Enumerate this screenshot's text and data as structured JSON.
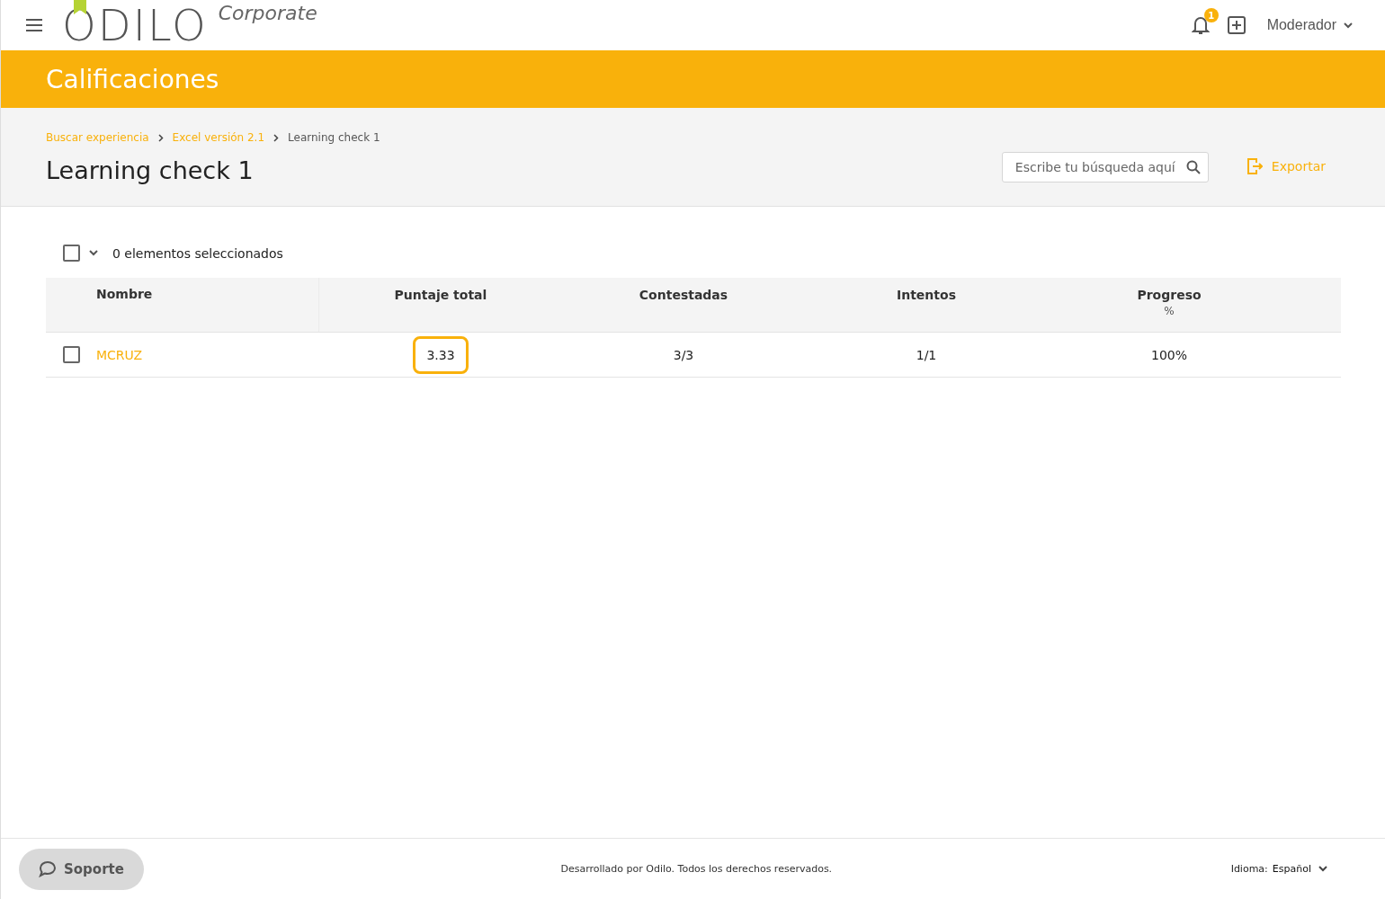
{
  "header": {
    "logo": "ODILO",
    "logo_suffix": "Corporate",
    "notification_count": "1",
    "user_menu": "Moderador"
  },
  "banner": {
    "title": "Calificaciones"
  },
  "breadcrumbs": [
    {
      "label": "Buscar experiencia",
      "kind": "link"
    },
    {
      "label": "Excel versión 2.1",
      "kind": "link"
    },
    {
      "label": "Learning check 1",
      "kind": "current"
    }
  ],
  "page_title": "Learning check 1",
  "search": {
    "placeholder": "Escribe tu búsqueda aquí"
  },
  "export_button": "Exportar",
  "selection": {
    "checked": false,
    "label": "0 elementos seleccionados"
  },
  "table": {
    "columns": [
      {
        "label": "Nombre"
      },
      {
        "label": "Puntaje total"
      },
      {
        "label": "Contestadas"
      },
      {
        "label": "Intentos"
      },
      {
        "label": "Progreso",
        "sublabel": "%"
      }
    ],
    "rows": [
      {
        "checked": false,
        "cells": [
          {
            "text": "MCRUZ",
            "kind": "link",
            "highlighted": false
          },
          {
            "text": "3.33",
            "kind": "text",
            "highlighted": true
          },
          {
            "text": "3/3",
            "kind": "text",
            "highlighted": false
          },
          {
            "text": "1/1",
            "kind": "text",
            "highlighted": false
          },
          {
            "text": "100%",
            "kind": "text",
            "highlighted": false
          }
        ]
      }
    ]
  },
  "footer": {
    "support_button": "Soporte",
    "copyright": "Desarrollado por Odilo. Todos los derechos reservados.",
    "language_label": "Idioma:",
    "language_value": "Español"
  }
}
